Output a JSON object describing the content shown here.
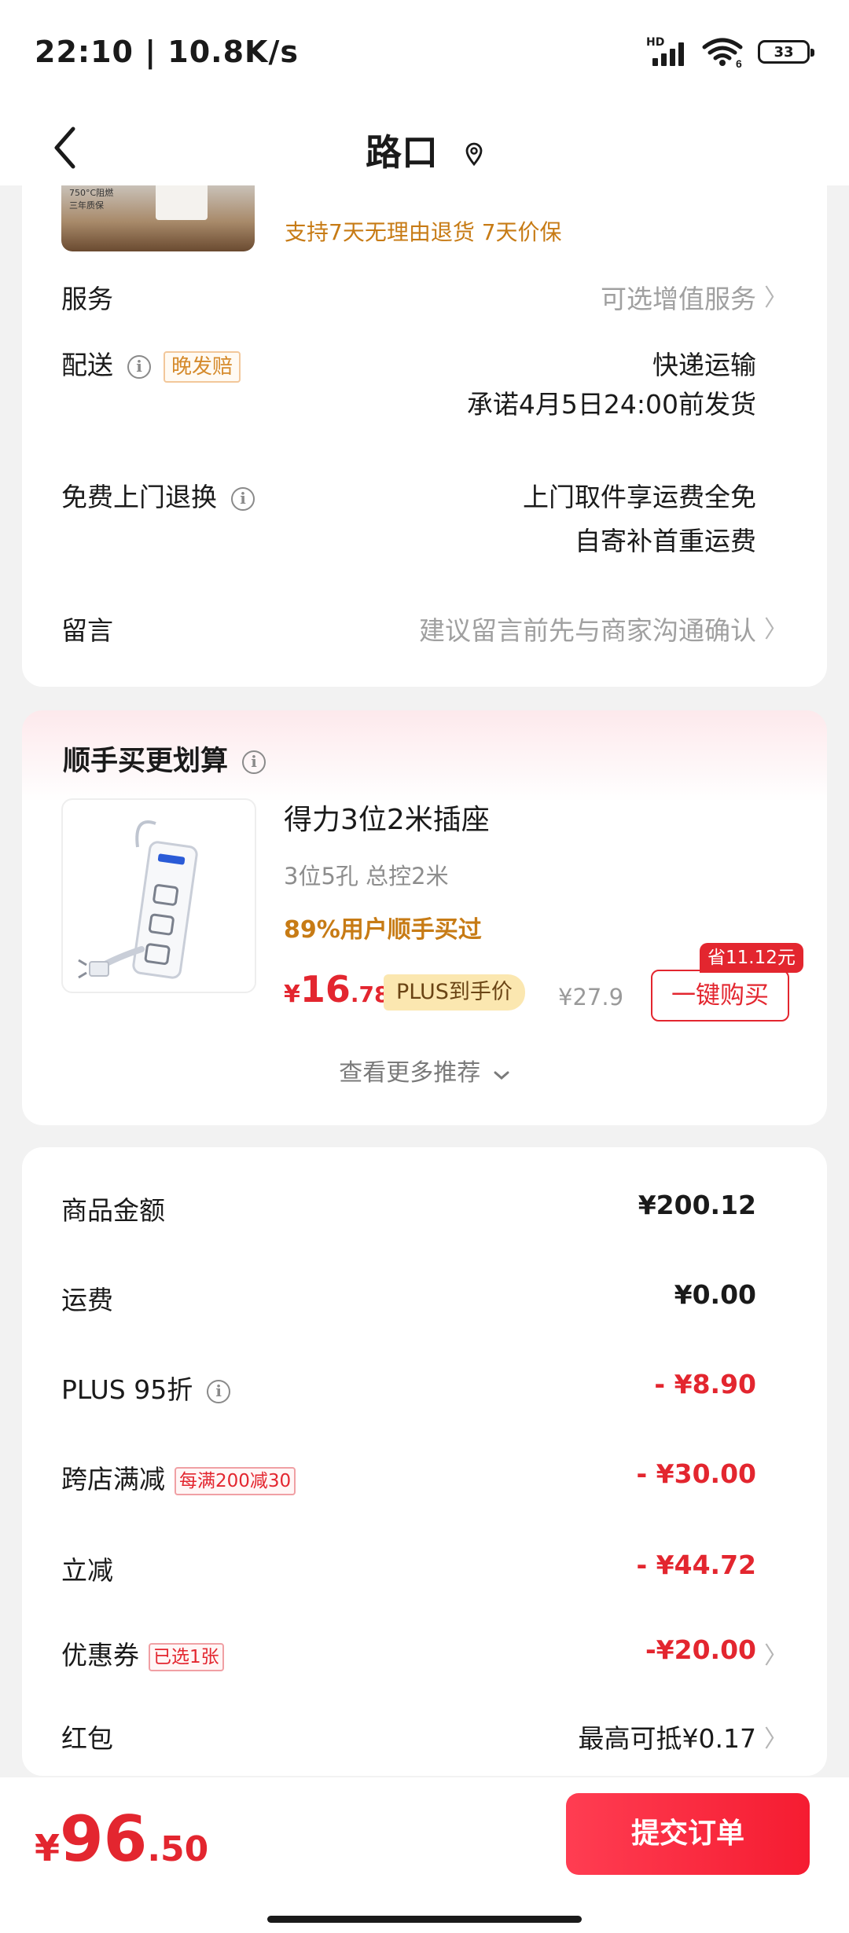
{
  "status_bar": {
    "time": "22:10 | 10.8K/s",
    "network": "HD",
    "wifi_badge": "6",
    "battery": "33"
  },
  "header": {
    "title": "路口",
    "icons": [
      "back-icon",
      "location-pin-icon"
    ]
  },
  "order_card": {
    "return_policy": "支持7天无理由退货  7天价保",
    "thumb_text": "750°C阻燃\n三年质保",
    "service": {
      "label": "服务",
      "value": "可选增值服务"
    },
    "delivery": {
      "label": "配送",
      "tag": "晚发赔",
      "value_line1": "快递运输",
      "value_line2": "承诺4月5日24:00前发货"
    },
    "return": {
      "label": "免费上门退换",
      "value_line1": "上门取件享运费全免",
      "value_line2": "自寄补首重运费"
    },
    "message": {
      "label": "留言",
      "placeholder": "建议留言前先与商家沟通确认"
    }
  },
  "recommend": {
    "title": "顺手买更划算",
    "product": {
      "name": "得力3位2米插座",
      "spec": "3位5孔 总控2米",
      "bought": "89%用户顺手买过",
      "price_currency": "¥",
      "price_int": "16",
      "price_dec": ".78",
      "plus_badge": "PLUS到手价",
      "original_price": "¥27.9",
      "save_tag": "省11.12元",
      "buy_label": "一键购买"
    },
    "more_label": "查看更多推荐"
  },
  "price_breakdown": {
    "goods": {
      "label": "商品金额",
      "value": "¥200.12"
    },
    "shipping": {
      "label": "运费",
      "value": "¥0.00"
    },
    "plus": {
      "label": "PLUS 95折",
      "value": "- ¥8.90"
    },
    "cross_store": {
      "label": "跨店满减",
      "tag": "每满200减30",
      "value": "- ¥30.00"
    },
    "instant": {
      "label": "立减",
      "value": "- ¥44.72"
    },
    "coupon": {
      "label": "优惠券",
      "tag": "已选1张",
      "value": "-¥20.00"
    },
    "redpacket": {
      "label": "红包",
      "value": "最高可抵¥0.17"
    }
  },
  "bottom": {
    "currency": "¥",
    "total_int": "96",
    "total_dec": ".50",
    "submit_label": "提交订单"
  },
  "colors": {
    "accent_red": "#e3262f",
    "accent_orange": "#c77b15",
    "plus_gold": "#fbe7b0"
  }
}
